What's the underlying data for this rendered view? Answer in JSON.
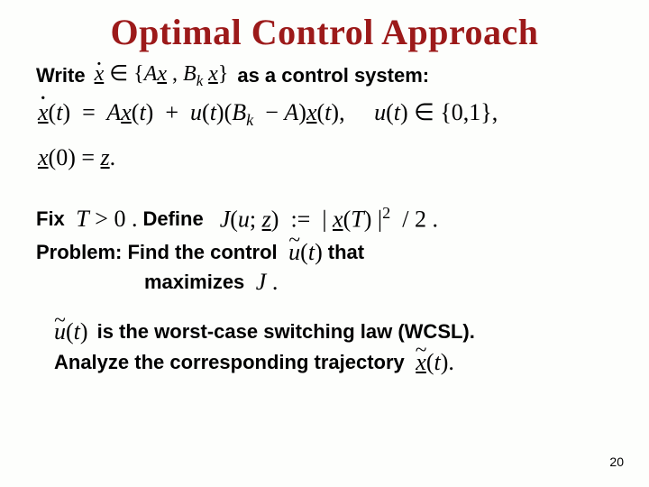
{
  "title": "Optimal Control Approach",
  "line_write": {
    "prefix": "Write",
    "inclusion_expr": "ẋ ∈ {Ax , B_k x}",
    "suffix": "as a control system:"
  },
  "system_eq": "ẋ(t) = A x(t) + u(t)(B_k − A) x(t),   u(t) ∈ {0,1},",
  "initial_eq": "x(0) = z.",
  "fix": {
    "fix_label": "Fix",
    "fix_expr": "T > 0 .",
    "define_label": "Define",
    "define_expr": "J(u; z) := | x(T) |² / 2 ."
  },
  "problem": {
    "label": "Problem: Find the control",
    "u_tilde": "ũ(t)",
    "that": "that",
    "maximizes": "maximizes",
    "J": "J ."
  },
  "wcsl": {
    "u_tilde": "ũ(t)",
    "line1": "is the worst-case switching law (WCSL).",
    "line2": "Analyze the corresponding trajectory",
    "x_tilde": "x̃(t)."
  },
  "page_number": "20"
}
